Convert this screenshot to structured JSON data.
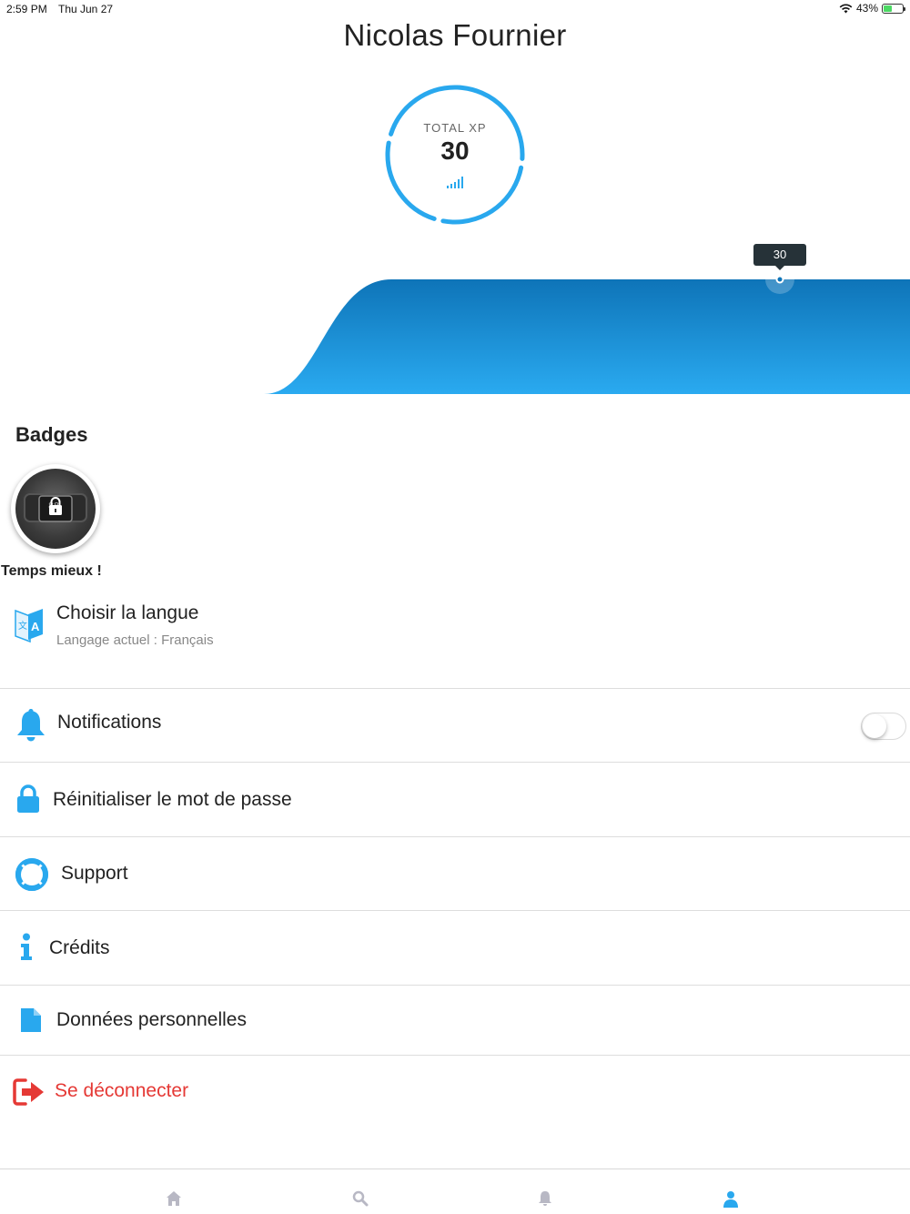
{
  "status_bar": {
    "time": "2:59 PM",
    "date": "Thu Jun 27",
    "battery": "43%",
    "battery_level": 0.43
  },
  "profile": {
    "name": "Nicolas Fournier"
  },
  "xp": {
    "label": "TOTAL XP",
    "value": "30",
    "ring_color": "#29a8ee"
  },
  "chart_data": {
    "type": "area",
    "tooltip": "30",
    "values": [
      0,
      30,
      30,
      30,
      30
    ],
    "ylim": [
      0,
      30
    ],
    "grid": false,
    "color_top": "#0e74b8",
    "color_bottom": "#2aaaf0"
  },
  "badges": {
    "title": "Badges",
    "items": [
      {
        "label": "Temps mieux !",
        "icon": "lock-icon"
      }
    ]
  },
  "language": {
    "title": "Choisir la langue",
    "subtitle": "Langage actuel : Français",
    "icon": "translate-icon"
  },
  "menu": {
    "notifications": {
      "label": "Notifications",
      "icon": "bell-icon",
      "enabled": false
    },
    "reset_password": {
      "label": "Réinitialiser le mot de passe",
      "icon": "lock-icon"
    },
    "support": {
      "label": "Support",
      "icon": "lifebuoy-icon"
    },
    "credits": {
      "label": "Crédits",
      "icon": "info-icon"
    },
    "personal_data": {
      "label": "Données personnelles",
      "icon": "document-icon"
    },
    "logout": {
      "label": "Se déconnecter",
      "icon": "logout-icon",
      "color": "#e53935"
    }
  },
  "tab_bar": {
    "items": [
      {
        "icon": "home-icon",
        "active": false
      },
      {
        "icon": "search-icon",
        "active": false
      },
      {
        "icon": "bell-icon",
        "active": false
      },
      {
        "icon": "user-icon",
        "active": true
      }
    ]
  },
  "colors": {
    "accent": "#29a8ee",
    "danger": "#e53935",
    "inactive_tab": "#b8b8c4"
  }
}
